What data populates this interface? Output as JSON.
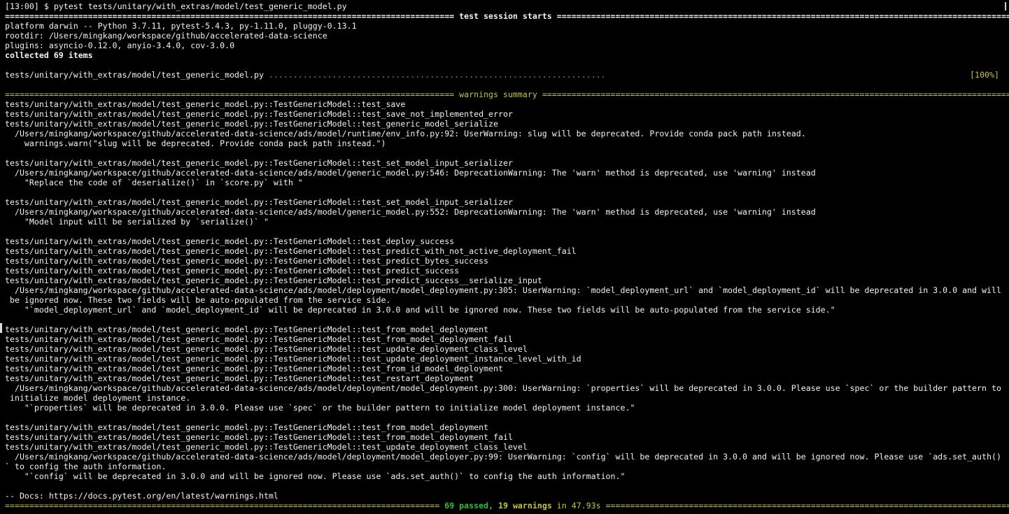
{
  "prompt": {
    "time": "[13:00",
    "symbol": "$",
    "command": "pytest tests/unitary/with_extras/model/test_generic_model.py"
  },
  "session": {
    "sep_left": "============================================================================================",
    "title": " test session starts ",
    "sep_right": "================================================================================================================"
  },
  "info": {
    "platform": "platform darwin -- Python 3.7.11, pytest-5.4.3, py-1.11.0, pluggy-0.13.1",
    "rootdir": "rootdir: /Users/mingkang/workspace/github/accelerated-data-science",
    "plugins": "plugins: asyncio-0.12.0, anyio-3.4.0, cov-3.0.0",
    "collected": "collected 69 items"
  },
  "run": {
    "file": "tests/unitary/with_extras/model/test_generic_model.py ",
    "dots": ".....................................................................",
    "percent": "[100%]"
  },
  "warnings_header": {
    "sep_left": "============================================================================================",
    "title": " warnings summary ",
    "sep_right": "================================================================================================================"
  },
  "blocks": [
    {
      "tests": [
        "tests/unitary/with_extras/model/test_generic_model.py::TestGenericModel::test_save",
        "tests/unitary/with_extras/model/test_generic_model.py::TestGenericModel::test_save_not_implemented_error",
        "tests/unitary/with_extras/model/test_generic_model.py::TestGenericModel::test_generic_model_serialize"
      ],
      "messages": [
        "  /Users/mingkang/workspace/github/accelerated-data-science/ads/model/runtime/env_info.py:92: UserWarning: slug will be deprecated. Provide conda pack path instead.",
        "    warnings.warn(\"slug will be deprecated. Provide conda pack path instead.\")"
      ]
    },
    {
      "tests": [
        "tests/unitary/with_extras/model/test_generic_model.py::TestGenericModel::test_set_model_input_serializer"
      ],
      "messages": [
        "  /Users/mingkang/workspace/github/accelerated-data-science/ads/model/generic_model.py:546: DeprecationWarning: The 'warn' method is deprecated, use 'warning' instead",
        "    \"Replace the code of `deserialize()` in `score.py` with \""
      ]
    },
    {
      "tests": [
        "tests/unitary/with_extras/model/test_generic_model.py::TestGenericModel::test_set_model_input_serializer"
      ],
      "messages": [
        "  /Users/mingkang/workspace/github/accelerated-data-science/ads/model/generic_model.py:552: DeprecationWarning: The 'warn' method is deprecated, use 'warning' instead",
        "    \"Model input will be serialized by `serialize()` \""
      ]
    },
    {
      "tests": [
        "tests/unitary/with_extras/model/test_generic_model.py::TestGenericModel::test_deploy_success",
        "tests/unitary/with_extras/model/test_generic_model.py::TestGenericModel::test_predict_with_not_active_deployment_fail",
        "tests/unitary/with_extras/model/test_generic_model.py::TestGenericModel::test_predict_bytes_success",
        "tests/unitary/with_extras/model/test_generic_model.py::TestGenericModel::test_predict_success",
        "tests/unitary/with_extras/model/test_generic_model.py::TestGenericModel::test_predict_success__serialize_input"
      ],
      "messages": [
        "  /Users/mingkang/workspace/github/accelerated-data-science/ads/model/deployment/model_deployment.py:305: UserWarning: `model_deployment_url` and `model_deployment_id` will be deprecated in 3.0.0 and will",
        " be ignored now. These two fields will be auto-populated from the service side.",
        "    \"`model_deployment_url` and `model_deployment_id` will be deprecated in 3.0.0 and will be ignored now. These two fields will be auto-populated from the service side.\""
      ]
    },
    {
      "tests": [
        "tests/unitary/with_extras/model/test_generic_model.py::TestGenericModel::test_from_model_deployment",
        "tests/unitary/with_extras/model/test_generic_model.py::TestGenericModel::test_from_model_deployment_fail",
        "tests/unitary/with_extras/model/test_generic_model.py::TestGenericModel::test_update_deployment_class_level",
        "tests/unitary/with_extras/model/test_generic_model.py::TestGenericModel::test_update_deployment_instance_level_with_id",
        "tests/unitary/with_extras/model/test_generic_model.py::TestGenericModel::test_from_id_model_deployment",
        "tests/unitary/with_extras/model/test_generic_model.py::TestGenericModel::test_restart_deployment"
      ],
      "messages": [
        "  /Users/mingkang/workspace/github/accelerated-data-science/ads/model/deployment/model_deployment.py:300: UserWarning: `properties` will be deprecated in 3.0.0. Please use `spec` or the builder pattern to",
        " initialize model deployment instance.",
        "    \"`properties` will be deprecated in 3.0.0. Please use `spec` or the builder pattern to initialize model deployment instance.\""
      ]
    },
    {
      "tests": [
        "tests/unitary/with_extras/model/test_generic_model.py::TestGenericModel::test_from_model_deployment",
        "tests/unitary/with_extras/model/test_generic_model.py::TestGenericModel::test_from_model_deployment_fail",
        "tests/unitary/with_extras/model/test_generic_model.py::TestGenericModel::test_update_deployment_class_level"
      ],
      "messages": [
        "  /Users/mingkang/workspace/github/accelerated-data-science/ads/model/deployment/model_deployer.py:99: UserWarning: `config` will be deprecated in 3.0.0 and will be ignored now. Please use `ads.set_auth()",
        "` to config the auth information.",
        "    \"`config` will be deprecated in 3.0.0 and will be ignored now. Please use `ads.set_auth()` to config the auth information.\""
      ]
    }
  ],
  "docs": "-- Docs: https://docs.pytest.org/en/latest/warnings.html",
  "summary": {
    "sep_left": "=========================================================================================",
    "passed": "69 passed",
    "comma": ", ",
    "warnings": "19 warnings",
    "time": " in 47.93s ",
    "sep_right": "================================================================================================================"
  },
  "colors": {
    "background": "#000000",
    "text": "#f2f2f2",
    "passed": "#2fbd3c",
    "warnings": "#c7c43c"
  }
}
